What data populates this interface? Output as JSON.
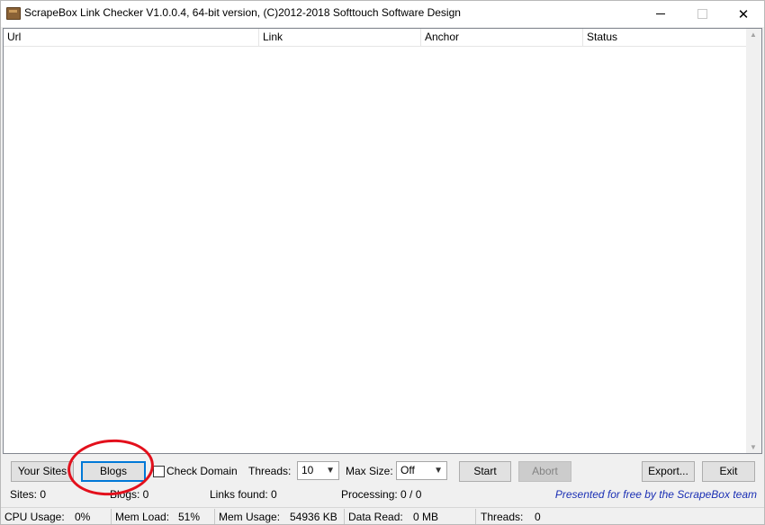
{
  "window": {
    "title": "ScrapeBox Link Checker V1.0.0.4, 64-bit version, (C)2012-2018 Softtouch Software Design",
    "controls": {
      "minimize": "minimize",
      "maximize": "maximize",
      "close": "✕"
    }
  },
  "table": {
    "columns": [
      "Url",
      "Link",
      "Anchor",
      "Status"
    ],
    "rows": []
  },
  "toolbar": {
    "your_sites": "Your Sites",
    "blogs": "Blogs",
    "check_domain": "Check Domain",
    "check_domain_checked": false,
    "threads_label": "Threads:",
    "threads_value": "10",
    "max_size_label": "Max Size:",
    "max_size_value": "Off",
    "start": "Start",
    "abort": "Abort",
    "export": "Export...",
    "exit": "Exit"
  },
  "info": {
    "sites": "Sites:  0",
    "blogs": "Blogs: 0",
    "links_found": "Links found:  0",
    "processing": "Processing:  0 / 0",
    "credit": "Presented for free by the ScrapeBox team"
  },
  "statusbar": {
    "cpu_label": "CPU Usage:",
    "cpu_value": "0%",
    "mem_load_label": "Mem Load:",
    "mem_load_value": "51%",
    "mem_usage_label": "Mem Usage:",
    "mem_usage_value": "54936 KB",
    "data_read_label": "Data Read:",
    "data_read_value": "0 MB",
    "threads_label": "Threads:",
    "threads_value": "0"
  },
  "colors": {
    "annotation": "#e3101c",
    "credit": "#1a2fb4",
    "focus": "#0078d7"
  }
}
